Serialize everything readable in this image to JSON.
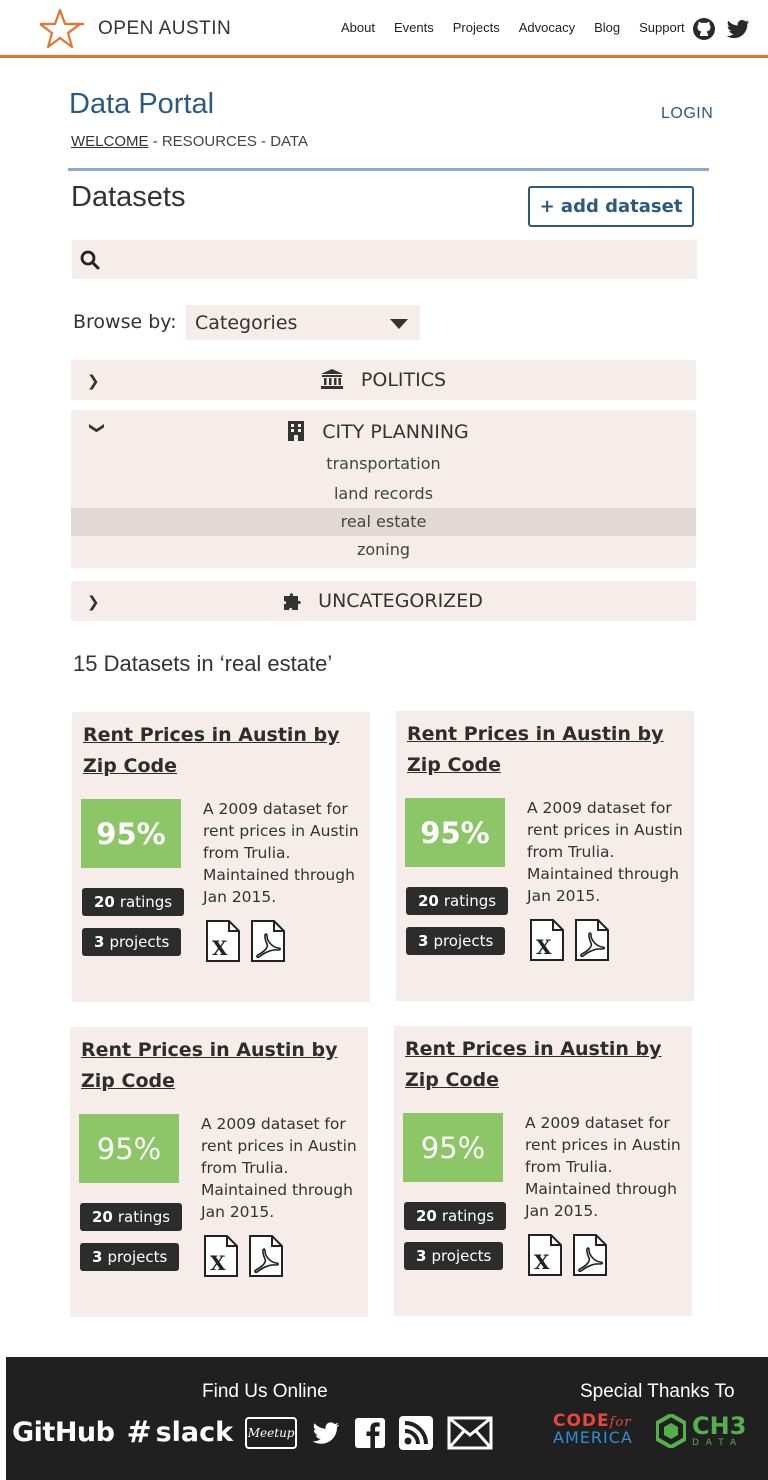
{
  "nav": {
    "brand": "OPEN AUSTIN",
    "links": [
      "About",
      "Events",
      "Projects",
      "Advocacy",
      "Blog",
      "Support"
    ],
    "icons": [
      "github-icon",
      "twitter-icon"
    ],
    "accent_color": "#e8732c"
  },
  "header": {
    "title": "Data Portal",
    "login": "LOGIN",
    "breadcrumb": {
      "welcome": "WELCOME",
      "rest": " - RESOURCES - DATA"
    }
  },
  "datasets": {
    "heading": "Datasets",
    "add_button": "+ add dataset",
    "search_placeholder": ""
  },
  "browse": {
    "label": "Browse by:",
    "selected": "Categories"
  },
  "categories": [
    {
      "name": "POLITICS",
      "icon": "institution-icon",
      "expanded": false
    },
    {
      "name": "CITY PLANNING",
      "icon": "building-icon",
      "expanded": true,
      "subcategories": [
        "transportation",
        "land records",
        "real estate",
        "zoning"
      ],
      "active_subcategory": "real estate"
    },
    {
      "name": "UNCATEGORIZED",
      "icon": "puzzle-icon",
      "expanded": false
    }
  ],
  "results": {
    "heading": "15 Datasets in ‘real estate’",
    "cards": [
      {
        "title": "Rent Prices in Austin by Zip Code",
        "score": "95%",
        "ratings_count": "20",
        "ratings_label": "ratings",
        "projects_count": "3",
        "projects_label": "projects",
        "description": "A 2009 dataset for rent prices in Austin from Trulia. Maintained through Jan 2015.",
        "files": [
          "excel-file-icon",
          "pdf-file-icon"
        ]
      },
      {
        "title": "Rent Prices in Austin by Zip Code",
        "score": "95%",
        "ratings_count": "20",
        "ratings_label": "ratings",
        "projects_count": "3",
        "projects_label": "projects",
        "description": "A 2009 dataset for rent prices in Austin from Trulia. Maintained through Jan 2015.",
        "files": [
          "excel-file-icon",
          "pdf-file-icon"
        ]
      },
      {
        "title": "Rent Prices in Austin by Zip Code",
        "score": "95%",
        "ratings_count": "20",
        "ratings_label": "ratings",
        "projects_count": "3",
        "projects_label": "projects",
        "description": "A 2009 dataset for rent prices in Austin from Trulia. Maintained through Jan 2015.",
        "files": [
          "excel-file-icon",
          "pdf-file-icon"
        ]
      },
      {
        "title": "Rent Prices in Austin by Zip Code",
        "score": "95%",
        "ratings_count": "20",
        "ratings_label": "ratings",
        "projects_count": "3",
        "projects_label": "projects",
        "description": "A 2009 dataset for rent prices in Austin from Trulia. Maintained through Jan 2015.",
        "files": [
          "excel-file-icon",
          "pdf-file-icon"
        ]
      }
    ],
    "score_color": "#8cc666"
  },
  "footer": {
    "find_heading": "Find Us Online",
    "thanks_heading": "Special Thanks To",
    "social": {
      "github": "GitHub",
      "slack": "slack",
      "meetup": "Meetup"
    },
    "sponsors": {
      "cfa_top": "CODE",
      "cfa_for": "for",
      "cfa_bottom": "AMERICA",
      "ch3_big": "CH3",
      "ch3_small": "DATA"
    }
  }
}
